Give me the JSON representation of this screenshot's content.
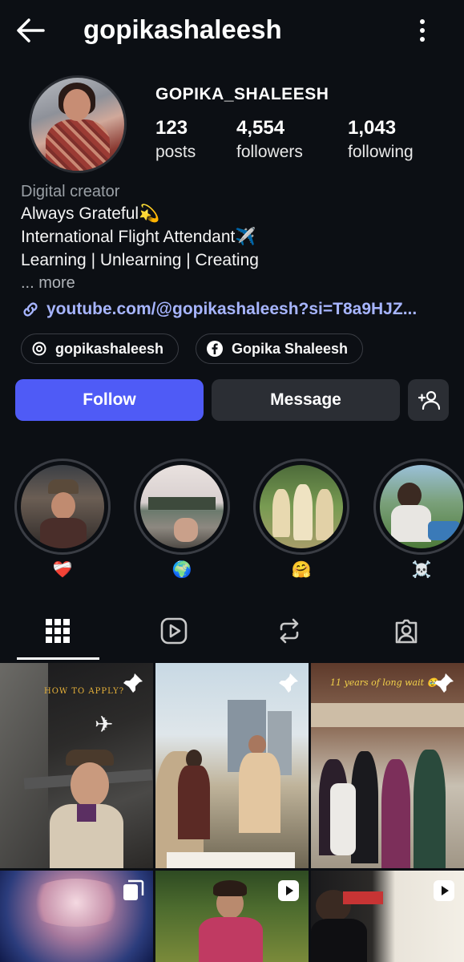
{
  "header": {
    "username": "gopikashaleesh",
    "back_icon": "arrow-left-icon",
    "menu_icon": "more-vertical-icon"
  },
  "profile": {
    "display_name": "GOPIKA_SHALEESH",
    "stats": [
      {
        "value": "123",
        "label": "posts"
      },
      {
        "value": "4,554",
        "label": "followers"
      },
      {
        "value": "1,043",
        "label": "following"
      }
    ]
  },
  "bio": {
    "category": "Digital creator",
    "lines": [
      "Always Grateful💫",
      "International Flight Attendant✈️",
      "Learning | Unlearning | Creating"
    ],
    "more": "... more",
    "link": "youtube.com/@gopikashaleesh?si=T8a9HJZ..."
  },
  "chips": [
    {
      "icon": "threads-icon",
      "label": "gopikashaleesh"
    },
    {
      "icon": "facebook-icon",
      "label": "Gopika Shaleesh"
    }
  ],
  "actions": {
    "follow": "Follow",
    "message": "Message",
    "add_icon": "add-person-icon"
  },
  "highlights": [
    {
      "emoji": "❤️‍🩹"
    },
    {
      "emoji": "🌍"
    },
    {
      "emoji": "🤗"
    },
    {
      "emoji": "☠️"
    }
  ],
  "tabs": [
    "grid-icon",
    "reels-icon",
    "reposts-icon",
    "tagged-icon"
  ],
  "posts": [
    {
      "overlay": "HOW TO APPLY?",
      "badge": "pin-icon"
    },
    {
      "overlay": "",
      "badge": "pin-icon"
    },
    {
      "overlay": "11 years of long wait 🥹",
      "badge": "pin-icon"
    },
    {
      "overlay": "",
      "badge": "carousel-icon"
    },
    {
      "overlay": "",
      "badge": "reel-icon"
    },
    {
      "overlay": "",
      "badge": "reel-icon"
    }
  ],
  "colors": {
    "background": "#0c0f14",
    "follow_button": "#4f5bf6",
    "secondary_button": "#2b2e34",
    "link": "#a7b5ff"
  }
}
